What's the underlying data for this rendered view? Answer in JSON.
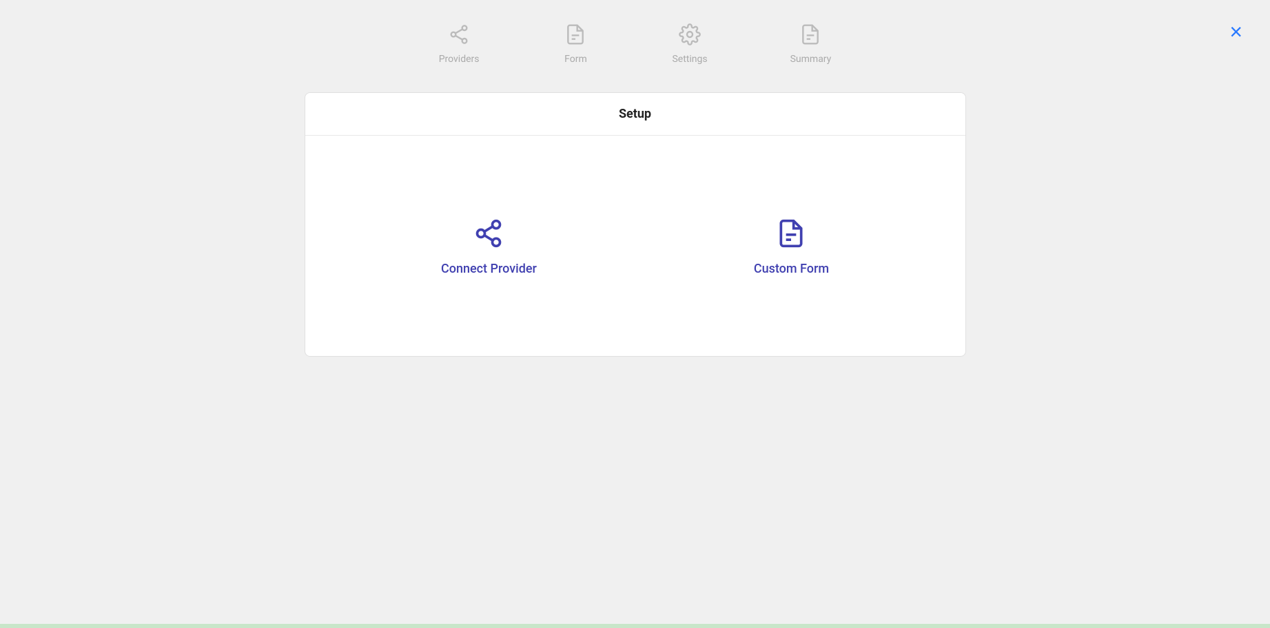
{
  "close_button_label": "×",
  "wizard": {
    "steps": [
      {
        "id": "providers",
        "label": "Providers",
        "icon": "share-icon"
      },
      {
        "id": "form",
        "label": "Form",
        "icon": "form-icon"
      },
      {
        "id": "settings",
        "label": "Settings",
        "icon": "settings-icon"
      },
      {
        "id": "summary",
        "label": "Summary",
        "icon": "summary-icon"
      }
    ]
  },
  "setup_card": {
    "title": "Setup",
    "options": [
      {
        "id": "connect-provider",
        "label": "Connect Provider",
        "icon": "connect-provider-icon"
      },
      {
        "id": "custom-form",
        "label": "Custom Form",
        "icon": "custom-form-icon"
      }
    ]
  }
}
